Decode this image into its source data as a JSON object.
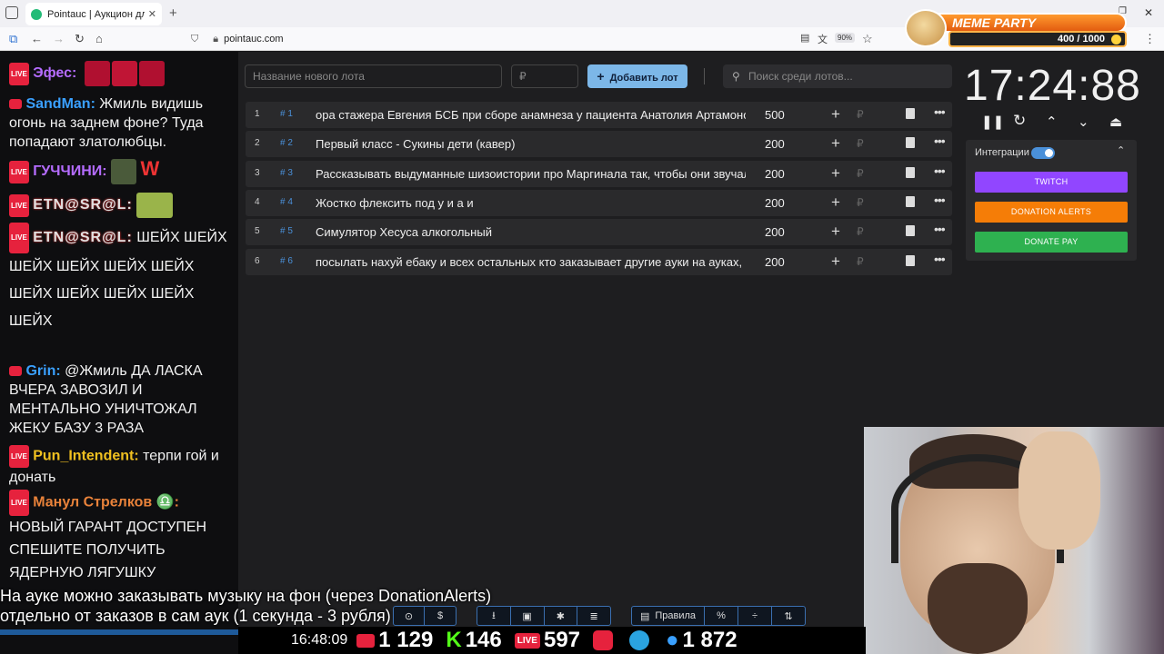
{
  "browser": {
    "tab_title": "Pointauc | Аукцион для стримеров",
    "url": "pointauc.com",
    "zoom": "90%"
  },
  "overlay": {
    "brand": "MEME PARTY",
    "score": "400 / 1000"
  },
  "chat": [
    {
      "nick": "Эфес:",
      "text": "",
      "nick_color": "#b56cff"
    },
    {
      "nick": "SandMan:",
      "text": "Жмиль видишь огонь на заднем фоне? Туда попадают златолюбцы.",
      "nick_color": "#3aa0ff"
    },
    {
      "nick": "ГУЧЧИНИ:",
      "text": "W",
      "nick_color": "#b56cff"
    },
    {
      "nick": "ETN@SR@L:",
      "text": "",
      "nick_color": "#e0e0e0"
    },
    {
      "nick": "ETN@SR@L:",
      "text": "ШЕЙХ ШЕЙХ ШЕЙХ ШЕЙХ ШЕЙХ ШЕЙХ ШЕЙХ ШЕЙХ ШЕЙХ ШЕЙХ ШЕЙХ",
      "nick_color": "#e0e0e0"
    },
    {
      "nick": "Grin:",
      "text": "@Жмиль ДА ЛАСКА ВЧЕРА ЗАВОЗИЛ И МЕНТАЛЬНО УНИЧТОЖАЛ ЖЕКУ БАЗУ 3 РАЗА",
      "nick_color": "#3aa0ff"
    },
    {
      "nick": "Pun_Intendent:",
      "text": "терпи гой и донать",
      "nick_color": "#f0c020"
    },
    {
      "nick": "Манул Стрелков ♎:",
      "text": "НОВЫЙ ГАРАНТ ДОСТУПЕН СПЕШИТЕ ПОЛУЧИТЬ ЯДЕРНУЮ ЛЯГУШКУ",
      "nick_color": "#e8823a"
    }
  ],
  "app": {
    "new_lot_placeholder": "Название нового лота",
    "amount_placeholder": "₽",
    "add_button": "Добавить лот",
    "search_placeholder": "Поиск среди лотов...",
    "lots": [
      {
        "pos": "1",
        "id": "# 1",
        "name": "ора стажера Евгения БСБ при сборе анамнеза у пациента Анатолия Артамонова",
        "amount": "500"
      },
      {
        "pos": "2",
        "id": "# 2",
        "name": "Первый класс - Сукины дети (кавер)",
        "amount": "200"
      },
      {
        "pos": "3",
        "id": "# 3",
        "name": "Рассказывать выдуманные шизоистории про Маргинала так, чтобы они звучали",
        "amount": "200"
      },
      {
        "pos": "4",
        "id": "# 4",
        "name": "Жостко флексить под у и а и",
        "amount": "200"
      },
      {
        "pos": "5",
        "id": "# 5",
        "name": "Симулятор Хесуса алкогольный",
        "amount": "200"
      },
      {
        "pos": "6",
        "id": "# 6",
        "name": "посылать нахуй ебаку и всех остальных кто заказывает другие ауки на ауках, го",
        "amount": "200"
      }
    ],
    "rub_symbol": "₽",
    "timer": "17:24:88",
    "integrations_label": "Интеграции",
    "integrations": [
      {
        "label": "TWITCH",
        "color": "#9146ff"
      },
      {
        "label": "DONATION ALERTS",
        "color": "#f57d07"
      },
      {
        "label": "DONATE PAY",
        "color": "#2eb150"
      }
    ],
    "rules_button": "Правила"
  },
  "ticker": {
    "line1": "На ауке можно заказывать музыку на фон (через DonationAlerts)",
    "line2": "отдельно от заказов в сам аук (1 секунда - 3 рубля)"
  },
  "stats": {
    "time": "16:48:09",
    "youtube": "1 129",
    "kick": "146",
    "live": "597",
    "viewers": "1 872"
  }
}
